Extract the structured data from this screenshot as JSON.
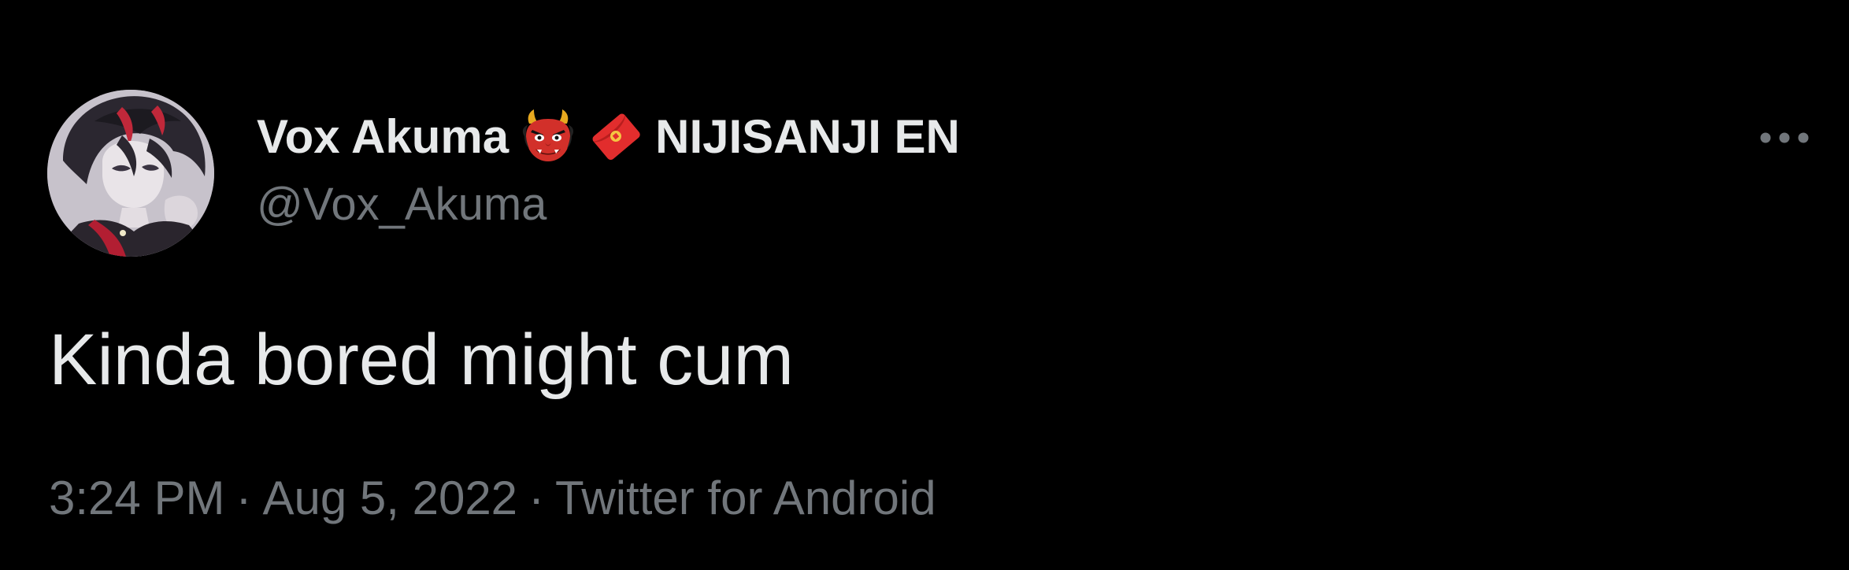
{
  "author": {
    "display_name_primary": "Vox Akuma",
    "display_name_secondary": "NIJISANJI EN",
    "handle": "@Vox_Akuma",
    "name_emojis": [
      "ogre-emoji",
      "red-envelope-emoji"
    ],
    "avatar": "profile-avatar"
  },
  "tweet": {
    "text": "Kinda bored might cum"
  },
  "meta": {
    "time": "3:24 PM",
    "separator": "·",
    "date": "Aug 5, 2022",
    "source": "Twitter for Android"
  },
  "menu": {
    "icon": "more-horizontal-icon"
  },
  "colors": {
    "background": "#000000",
    "primary_text": "#e7e9ea",
    "secondary_text": "#71767b"
  }
}
